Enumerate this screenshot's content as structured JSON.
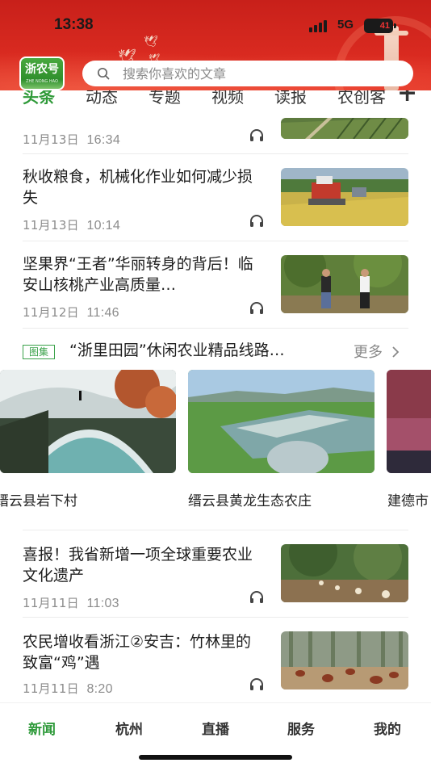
{
  "status_bar": {
    "time": "13:38",
    "network": "5G",
    "battery": "41"
  },
  "header": {
    "logo_text": "浙农号",
    "logo_sub": "ZHE NONG HAO",
    "search_placeholder": "搜索你喜欢的文章"
  },
  "tabs": [
    {
      "label": "头条",
      "active": true
    },
    {
      "label": "动态",
      "active": false
    },
    {
      "label": "专题",
      "active": false
    },
    {
      "label": "视频",
      "active": false
    },
    {
      "label": "读报",
      "active": false
    },
    {
      "label": "农创客",
      "active": false
    }
  ],
  "tab_add_label": "+",
  "news": [
    {
      "title": "",
      "date": "11月13日",
      "time": "16:34"
    },
    {
      "title": "秋收粮食，机械化作业如何减少损失",
      "date": "11月13日",
      "time": "10:14"
    },
    {
      "title": "坚果界“王者”华丽转身的背后！临安山核桃产业高质量…",
      "date": "11月12日",
      "time": "11:46"
    },
    {
      "title": "喜报！我省新增一项全球重要农业文化遗产",
      "date": "11月11日",
      "time": "11:03"
    },
    {
      "title": "农民增收看浙江②安吉：竹林里的致富“鸡”遇",
      "date": "11月11日",
      "time": "8:20"
    }
  ],
  "gallery": {
    "badge": "图集",
    "title": "“浙里田园”休闲农业精品线路…",
    "more": "更多",
    "items": [
      {
        "caption": "缙云县岩下村"
      },
      {
        "caption": "缙云县黄龙生态农庄"
      },
      {
        "caption": "建德市"
      }
    ]
  },
  "bottom_nav": [
    {
      "label": "新闻",
      "active": true
    },
    {
      "label": "杭州",
      "active": false
    },
    {
      "label": "直播",
      "active": false
    },
    {
      "label": "服务",
      "active": false
    },
    {
      "label": "我的",
      "active": false
    }
  ],
  "colors": {
    "brand_red": "#d62a20",
    "brand_green": "#2f9a39",
    "meta_gray": "#8c8c8c"
  }
}
